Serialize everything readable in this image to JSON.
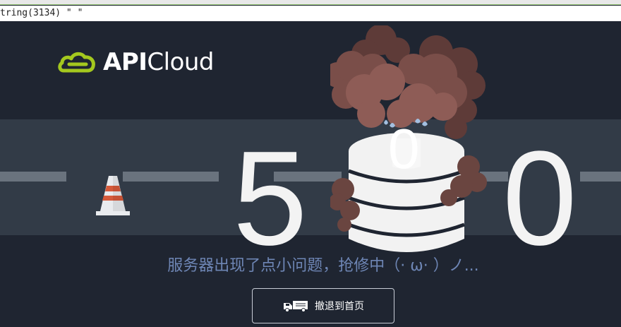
{
  "debug_line": "tring(3134) \" \"",
  "logo": {
    "prefix": "API",
    "suffix": "Cloud",
    "icon": "cloud-logo-icon"
  },
  "error": {
    "digit1": "5",
    "digit2": "0",
    "digit3": "0"
  },
  "message": "服务器出现了点小问题，抢修中（· ω· ）ノ...",
  "home_button": {
    "label": "撤退到首页",
    "icon": "truck-icon"
  },
  "colors": {
    "background": "#1f2531",
    "road": "#323b47",
    "accent": "#a4c81e",
    "message": "#6e86b5"
  }
}
